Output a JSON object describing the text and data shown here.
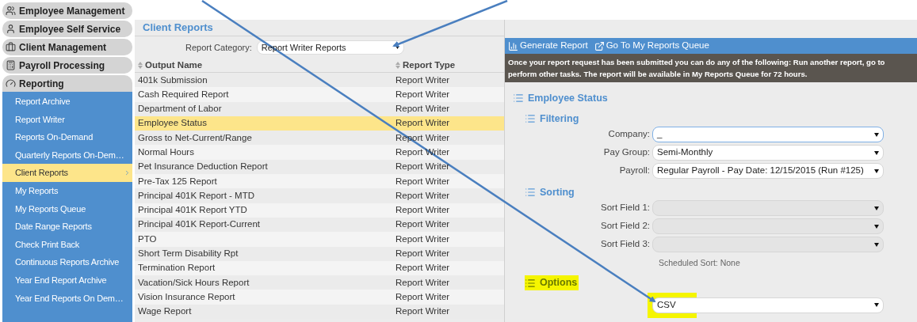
{
  "sidebar": {
    "modules": [
      {
        "label": "Employee Management",
        "expanded": false
      },
      {
        "label": "Employee Self Service",
        "expanded": false
      },
      {
        "label": "Client Management",
        "expanded": false
      },
      {
        "label": "Payroll Processing",
        "expanded": false
      },
      {
        "label": "Reporting",
        "expanded": true,
        "children": [
          {
            "label": "Report Archive",
            "selected": false
          },
          {
            "label": "Report Writer",
            "selected": false
          },
          {
            "label": "Reports On-Demand",
            "selected": false
          },
          {
            "label": "Quarterly Reports On-Dem…",
            "selected": false
          },
          {
            "label": "Client Reports",
            "selected": true
          },
          {
            "label": "My Reports",
            "selected": false
          },
          {
            "label": "My Reports Queue",
            "selected": false
          },
          {
            "label": "Date Range Reports",
            "selected": false
          },
          {
            "label": "Check Print Back",
            "selected": false
          },
          {
            "label": "Continuous Reports Archive",
            "selected": false
          },
          {
            "label": "Year End Report Archive",
            "selected": false
          },
          {
            "label": "Year End Reports On Dem…",
            "selected": false
          }
        ]
      }
    ]
  },
  "page": {
    "title": "Client Reports",
    "category": {
      "label": "Report Category:",
      "value": "Report Writer Reports"
    }
  },
  "table": {
    "columns": [
      "Output Name",
      "Report Type"
    ],
    "rows": [
      {
        "cells": [
          "401k Submission",
          "Report Writer"
        ],
        "selected": false
      },
      {
        "cells": [
          "Cash Required Report",
          "Report Writer"
        ],
        "selected": false
      },
      {
        "cells": [
          "Department of Labor",
          "Report Writer"
        ],
        "selected": false
      },
      {
        "cells": [
          "Employee Status",
          "Report Writer"
        ],
        "selected": true
      },
      {
        "cells": [
          "Gross to Net-Current/Range",
          "Report Writer"
        ],
        "selected": false
      },
      {
        "cells": [
          "Normal Hours",
          "Report Writer"
        ],
        "selected": false
      },
      {
        "cells": [
          "Pet Insurance Deduction Report",
          "Report Writer"
        ],
        "selected": false
      },
      {
        "cells": [
          "Pre-Tax 125 Report",
          "Report Writer"
        ],
        "selected": false
      },
      {
        "cells": [
          "Principal 401K Report - MTD",
          "Report Writer"
        ],
        "selected": false
      },
      {
        "cells": [
          "Principal 401K Report YTD",
          "Report Writer"
        ],
        "selected": false
      },
      {
        "cells": [
          "Principal 401K Report-Current",
          "Report Writer"
        ],
        "selected": false
      },
      {
        "cells": [
          "PTO",
          "Report Writer"
        ],
        "selected": false
      },
      {
        "cells": [
          "Short Term Disability Rpt",
          "Report Writer"
        ],
        "selected": false
      },
      {
        "cells": [
          "Termination Report",
          "Report Writer"
        ],
        "selected": false
      },
      {
        "cells": [
          "Vacation/Sick Hours Report",
          "Report Writer"
        ],
        "selected": false
      },
      {
        "cells": [
          "Vision Insurance Report",
          "Report Writer"
        ],
        "selected": false
      },
      {
        "cells": [
          "Wage Report",
          "Report Writer"
        ],
        "selected": false
      }
    ]
  },
  "toolbar": {
    "buttons": [
      "Generate Report",
      "Go To My Reports Queue"
    ]
  },
  "notice": [
    "Once your report request has been submitted you can do any of the following: Run another report, go to",
    "perform other tasks. The report will be available in My Reports Queue for 72 hours."
  ],
  "report": {
    "title": "Employee Status",
    "sections": [
      {
        "title": "Filtering",
        "highlighted": false,
        "fields": [
          {
            "label": "Company:",
            "value": "_",
            "disabled": false,
            "focused": true,
            "highlighted": false
          },
          {
            "label": "Pay Group:",
            "value": "Semi-Monthly",
            "disabled": false,
            "focused": false,
            "highlighted": false
          },
          {
            "label": "Payroll:",
            "value": "Regular Payroll - Pay Date: 12/15/2015 (Run #125)",
            "disabled": false,
            "focused": false,
            "highlighted": false
          }
        ]
      },
      {
        "title": "Sorting",
        "highlighted": false,
        "fields": [
          {
            "label": "Sort Field 1:",
            "disabled": true,
            "focused": false,
            "highlighted": false
          },
          {
            "label": "Sort Field 2:",
            "disabled": true,
            "focused": false,
            "highlighted": false
          },
          {
            "label": "Sort Field 3:",
            "disabled": true,
            "focused": false,
            "highlighted": false
          }
        ],
        "note": "Scheduled Sort: None"
      },
      {
        "title": "Options",
        "highlighted": true,
        "fields": [
          {
            "value": "CSV",
            "disabled": false,
            "focused": false,
            "highlighted": true
          }
        ]
      }
    ]
  }
}
